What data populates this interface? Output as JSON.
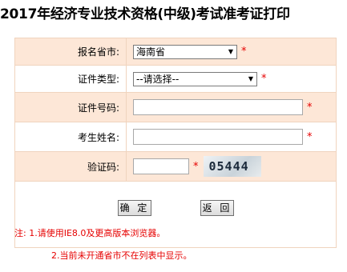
{
  "page": {
    "title": "2017年经济专业技术资格(中级)考试准考证打印"
  },
  "form": {
    "province": {
      "label": "报名省市:",
      "selected": "海南省"
    },
    "id_type": {
      "label": "证件类型:",
      "selected": "--请选择--"
    },
    "id_number": {
      "label": "证件号码:",
      "value": ""
    },
    "name": {
      "label": "考生姓名:",
      "value": ""
    },
    "captcha": {
      "label": "验证码:",
      "value": "",
      "image_text": "05444"
    },
    "required_mark": "*"
  },
  "buttons": {
    "confirm": "确 定",
    "back": "返 回"
  },
  "notes": {
    "line1": "注: 1.请使用IE8.0及更高版本浏览器。",
    "line2": "2.当前未开通省市不在列表中显示。"
  },
  "colors": {
    "row_shade": "#fde7d7",
    "border": "#f0d4be",
    "required": "#e60000"
  }
}
